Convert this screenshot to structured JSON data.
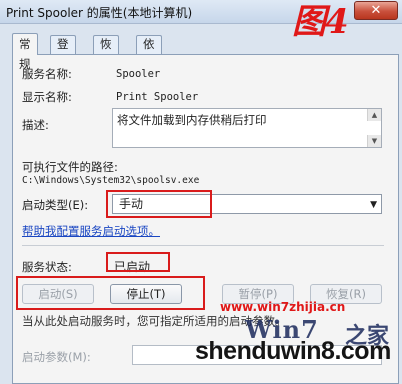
{
  "window": {
    "title": "Print Spooler 的属性(本地计算机)",
    "close_label": "✕",
    "stamp": "图4"
  },
  "tabs": [
    "常规",
    "登录",
    "恢复",
    "依存关系"
  ],
  "general": {
    "service_name_label": "服务名称:",
    "service_name_value": "Spooler",
    "display_name_label": "显示名称:",
    "display_name_value": "Print Spooler",
    "description_label": "描述:",
    "description_value": "将文件加载到内存供稍后打印",
    "path_label": "可执行文件的路径:",
    "path_value": "C:\\Windows\\System32\\spoolsv.exe",
    "startup_type_label": "启动类型(E):",
    "startup_type_value": "手动",
    "help_link": "帮助我配置服务启动选项。",
    "status_label": "服务状态:",
    "status_value": "已启动",
    "buttons": {
      "start": "启动(S)",
      "stop": "停止(T)",
      "pause": "暂停(P)",
      "resume": "恢复(R)"
    },
    "hint_text": "当从此处启动服务时，您可指定所适用的启动参数。",
    "start_params_label": "启动参数(M):"
  },
  "watermark": {
    "url": "www.win7zhijia.cn",
    "logo": "Win7",
    "logo_cn": "之家",
    "site": "shenduwin8.com"
  }
}
